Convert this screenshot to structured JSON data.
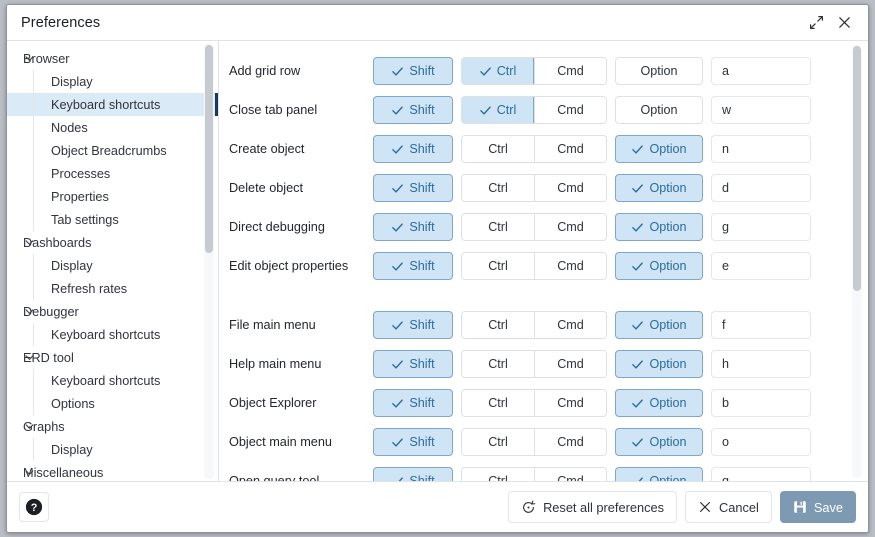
{
  "window": {
    "title": "Preferences",
    "expand_icon": "expand-diagonal-icon",
    "close_icon": "close-icon"
  },
  "sidebar": {
    "items": [
      {
        "label": "Browser",
        "level": 0,
        "expanded": true,
        "selected": false
      },
      {
        "label": "Display",
        "level": 1,
        "expanded": false,
        "selected": false
      },
      {
        "label": "Keyboard shortcuts",
        "level": 1,
        "expanded": false,
        "selected": true
      },
      {
        "label": "Nodes",
        "level": 1,
        "expanded": false,
        "selected": false
      },
      {
        "label": "Object Breadcrumbs",
        "level": 1,
        "expanded": false,
        "selected": false
      },
      {
        "label": "Processes",
        "level": 1,
        "expanded": false,
        "selected": false
      },
      {
        "label": "Properties",
        "level": 1,
        "expanded": false,
        "selected": false
      },
      {
        "label": "Tab settings",
        "level": 1,
        "expanded": false,
        "selected": false
      },
      {
        "label": "Dashboards",
        "level": 0,
        "expanded": true,
        "selected": false
      },
      {
        "label": "Display",
        "level": 1,
        "expanded": false,
        "selected": false
      },
      {
        "label": "Refresh rates",
        "level": 1,
        "expanded": false,
        "selected": false
      },
      {
        "label": "Debugger",
        "level": 0,
        "expanded": true,
        "selected": false
      },
      {
        "label": "Keyboard shortcuts",
        "level": 1,
        "expanded": false,
        "selected": false
      },
      {
        "label": "ERD tool",
        "level": 0,
        "expanded": true,
        "selected": false
      },
      {
        "label": "Keyboard shortcuts",
        "level": 1,
        "expanded": false,
        "selected": false
      },
      {
        "label": "Options",
        "level": 1,
        "expanded": false,
        "selected": false
      },
      {
        "label": "Graphs",
        "level": 0,
        "expanded": true,
        "selected": false
      },
      {
        "label": "Display",
        "level": 1,
        "expanded": false,
        "selected": false
      },
      {
        "label": "Miscellaneous",
        "level": 0,
        "expanded": true,
        "selected": false
      }
    ],
    "scrollbar": {
      "name": "sidebar-scrollbar"
    }
  },
  "main": {
    "modifier_labels": {
      "shift": "Shift",
      "ctrl": "Ctrl",
      "cmd": "Cmd",
      "option": "Option"
    },
    "rows": [
      {
        "label": "Add grid row",
        "shift": true,
        "ctrl": true,
        "cmd": false,
        "option": false,
        "key": "a",
        "tall": false
      },
      {
        "label": "Close tab panel",
        "shift": true,
        "ctrl": true,
        "cmd": false,
        "option": false,
        "key": "w",
        "tall": false
      },
      {
        "label": "Create object",
        "shift": true,
        "ctrl": false,
        "cmd": false,
        "option": true,
        "key": "n",
        "tall": false
      },
      {
        "label": "Delete object",
        "shift": true,
        "ctrl": false,
        "cmd": false,
        "option": true,
        "key": "d",
        "tall": false
      },
      {
        "label": "Direct debugging",
        "shift": true,
        "ctrl": false,
        "cmd": false,
        "option": true,
        "key": "g",
        "tall": false
      },
      {
        "label": "Edit object properties",
        "shift": true,
        "ctrl": false,
        "cmd": false,
        "option": true,
        "key": "e",
        "tall": true
      },
      {
        "label": "File main menu",
        "shift": true,
        "ctrl": false,
        "cmd": false,
        "option": true,
        "key": "f",
        "tall": false
      },
      {
        "label": "Help main menu",
        "shift": true,
        "ctrl": false,
        "cmd": false,
        "option": true,
        "key": "h",
        "tall": false
      },
      {
        "label": "Object Explorer",
        "shift": true,
        "ctrl": false,
        "cmd": false,
        "option": true,
        "key": "b",
        "tall": false
      },
      {
        "label": "Object main menu",
        "shift": true,
        "ctrl": false,
        "cmd": false,
        "option": true,
        "key": "o",
        "tall": false
      },
      {
        "label": "Open query tool",
        "shift": true,
        "ctrl": false,
        "cmd": false,
        "option": true,
        "key": "q",
        "tall": false
      }
    ],
    "scrollbar": {
      "name": "main-scrollbar"
    }
  },
  "footer": {
    "help_label": "?",
    "reset_label": "Reset all preferences",
    "cancel_label": "Cancel",
    "save_label": "Save"
  },
  "colors": {
    "accent_checked_bg": "#cfe4f5",
    "accent_checked_border": "#7fa7c8",
    "accent_checked_text": "#2c6ca0",
    "selection_bg": "#dbeaf7",
    "selection_marker": "#123a63",
    "primary_button_bg": "#7e99b2"
  }
}
